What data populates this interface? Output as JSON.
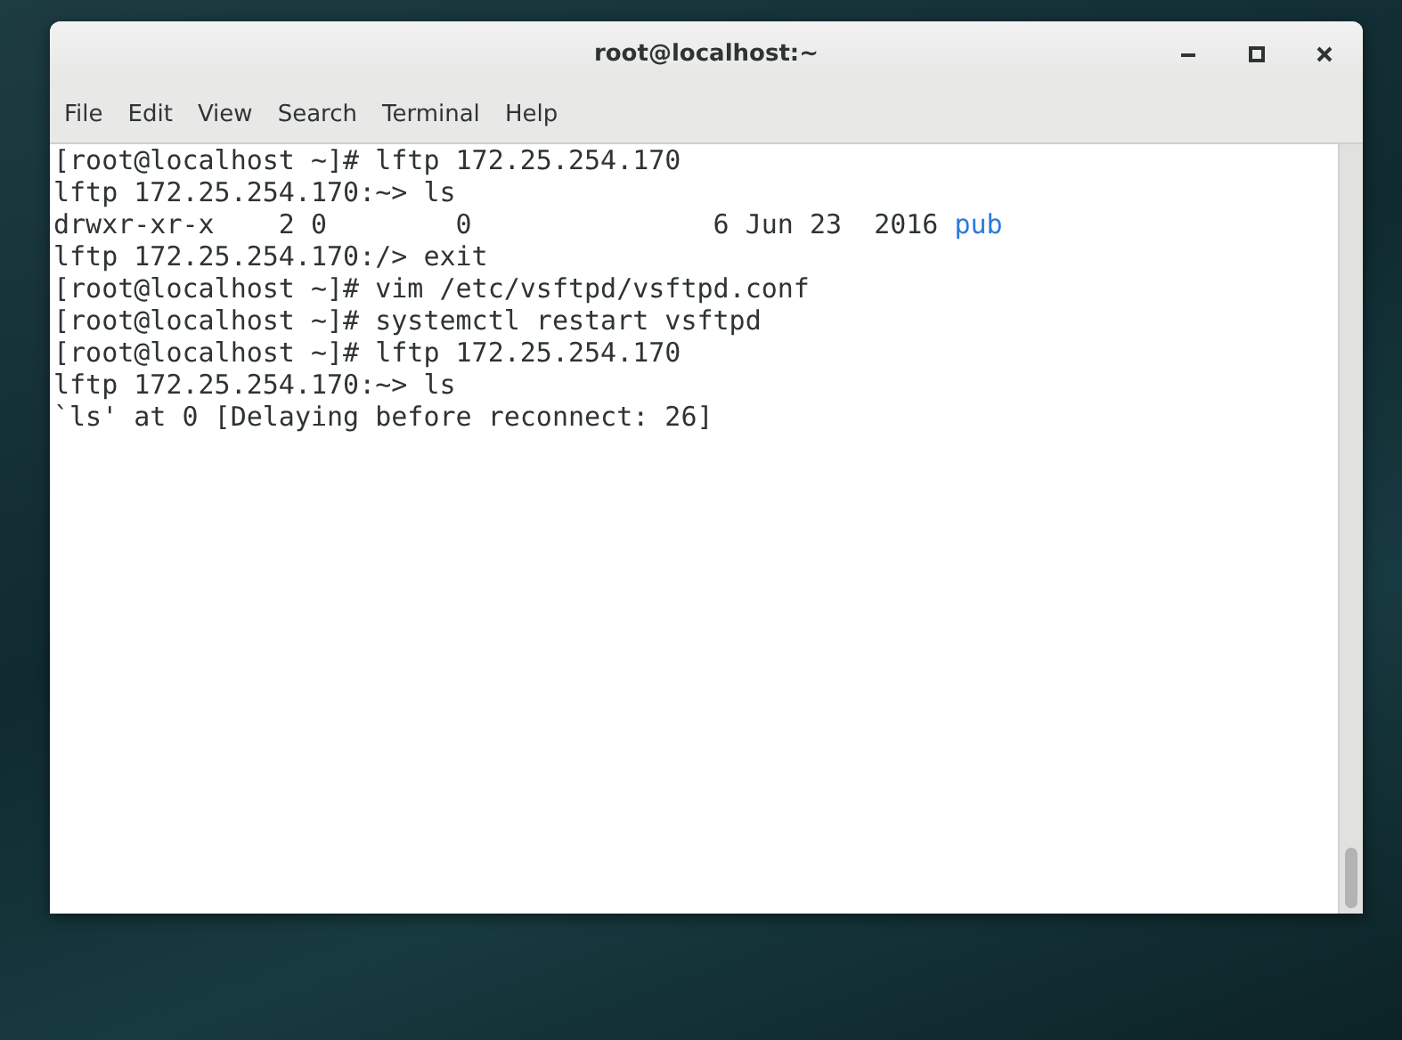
{
  "window": {
    "title": "root@localhost:~"
  },
  "menu": [
    "File",
    "Edit",
    "View",
    "Search",
    "Terminal",
    "Help"
  ],
  "terminal": {
    "lines": [
      [
        {
          "text": "[root@localhost ~]# lftp 172.25.254.170",
          "kind": "plain"
        }
      ],
      [
        {
          "text": "lftp 172.25.254.170:~> ls",
          "kind": "plain"
        }
      ],
      [
        {
          "text": "drwxr-xr-x    2 0        0               6 Jun 23  2016 ",
          "kind": "plain"
        },
        {
          "text": "pub",
          "kind": "directory"
        }
      ],
      [
        {
          "text": "lftp 172.25.254.170:/> exit",
          "kind": "plain"
        }
      ],
      [
        {
          "text": "[root@localhost ~]# vim /etc/vsftpd/vsftpd.conf",
          "kind": "plain"
        }
      ],
      [
        {
          "text": "[root@localhost ~]# systemctl restart vsftpd",
          "kind": "plain"
        }
      ],
      [
        {
          "text": "[root@localhost ~]# lftp 172.25.254.170",
          "kind": "plain"
        }
      ],
      [
        {
          "text": "lftp 172.25.254.170:~> ls",
          "kind": "plain"
        }
      ],
      [
        {
          "text": "`ls' at 0 [Delaying before reconnect: 26]",
          "kind": "plain"
        }
      ]
    ]
  }
}
